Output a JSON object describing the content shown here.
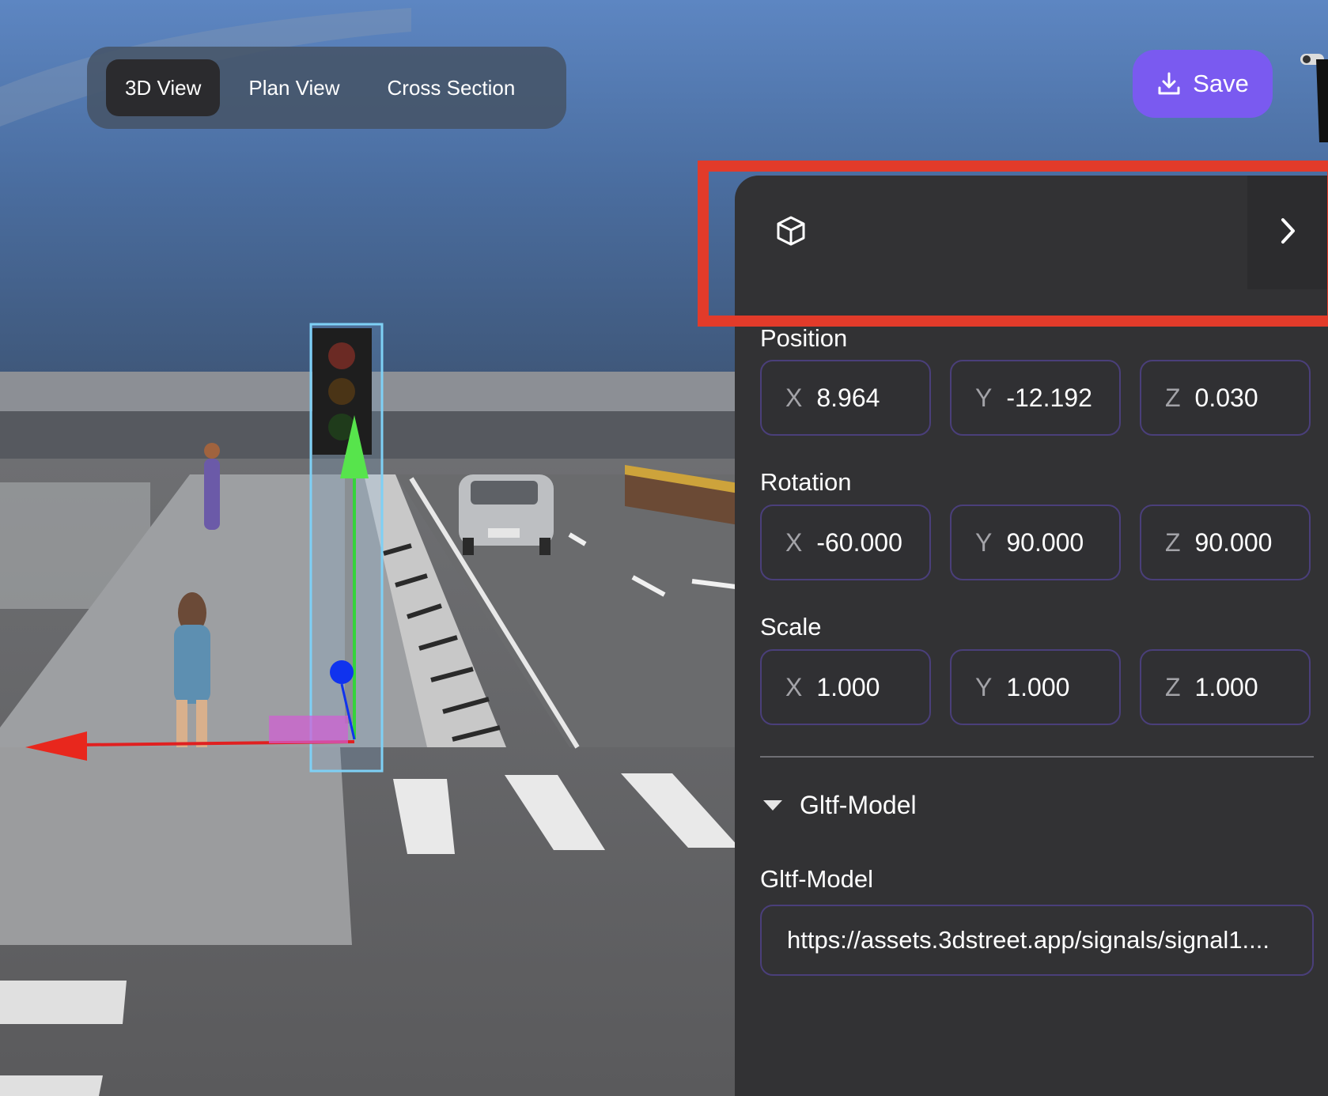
{
  "view_tabs": {
    "items": [
      {
        "label": "3D View",
        "active": true
      },
      {
        "label": "Plan View",
        "active": false
      },
      {
        "label": "Cross Section",
        "active": false
      }
    ]
  },
  "save": {
    "label": "Save",
    "icon": "download-icon",
    "color": "#7a5af0"
  },
  "highlight_color": "#e23b2a",
  "panel": {
    "header_icon": "cube-icon",
    "collapse_icon": "chevron-right-icon",
    "position": {
      "label": "Position",
      "x": "8.964",
      "y": "-12.192",
      "z": "0.030"
    },
    "rotation": {
      "label": "Rotation",
      "x": "-60.000",
      "y": "90.000",
      "z": "90.000"
    },
    "scale": {
      "label": "Scale",
      "x": "1.000",
      "y": "1.000",
      "z": "1.000"
    },
    "axis_labels": {
      "x": "X",
      "y": "Y",
      "z": "Z"
    },
    "component": {
      "title": "Gltf-Model",
      "field_label": "Gltf-Model",
      "field_value": "https://assets.3dstreet.app/signals/signal1...."
    }
  }
}
